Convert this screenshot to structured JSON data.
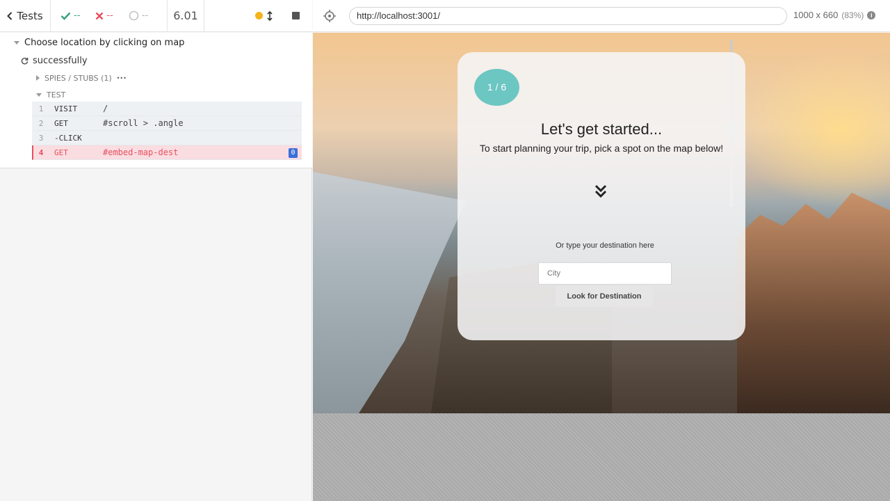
{
  "reporter": {
    "header": {
      "tests_label": "Tests",
      "passed": "--",
      "failed": "--",
      "pending": "--",
      "duration": "6.01"
    },
    "suite_title": "Choose location by clicking on map",
    "test_title": "successfully",
    "spies_label": "SPIES / STUBS (1)",
    "spies_more": "•••",
    "test_label": "TEST",
    "commands": [
      {
        "num": "1",
        "name": "VISIT",
        "message": "/"
      },
      {
        "num": "2",
        "name": "GET",
        "message": "#scroll > .angle"
      },
      {
        "num": "3",
        "name": "-CLICK",
        "message": ""
      },
      {
        "num": "4",
        "name": "GET",
        "message": "#embed-map-dest",
        "badge": "0",
        "state": "failed"
      }
    ]
  },
  "aut": {
    "url": "http://localhost:3001/",
    "viewport": "1000 x 660",
    "scale": "(83%)",
    "card": {
      "step": "1 / 6",
      "title": "Let's get started...",
      "subtitle": "To start planning your trip, pick a spot on the map below!",
      "or_text": "Or type your destination here",
      "city_placeholder": "City",
      "button_label": "Look for Destination"
    }
  },
  "colors": {
    "pass": "#3aa57a",
    "fail": "#e94f5f",
    "running": "#f5b31b",
    "step_circle": "#6cc6c2",
    "badge": "#3b6fd9"
  }
}
